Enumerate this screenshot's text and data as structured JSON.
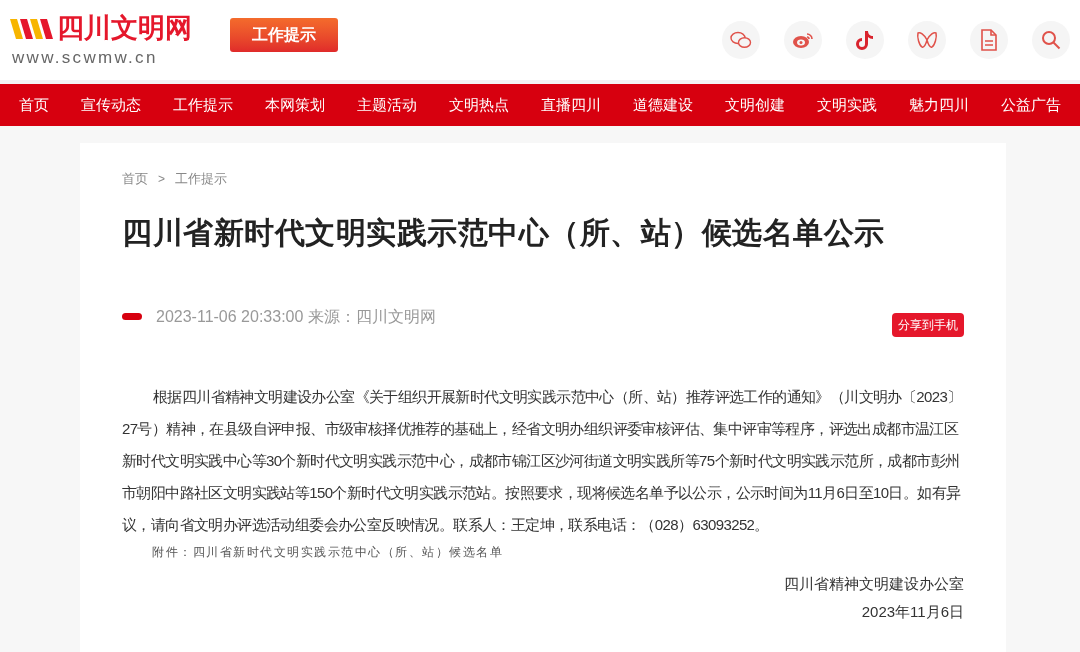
{
  "header": {
    "logo_title": "四川文明网",
    "logo_url": "www.scwmw.cn",
    "badge": "工作提示"
  },
  "nav": [
    {
      "label": "首页"
    },
    {
      "label": "宣传动态"
    },
    {
      "label": "工作提示"
    },
    {
      "label": "本网策划"
    },
    {
      "label": "主题活动"
    },
    {
      "label": "文明热点"
    },
    {
      "label": "直播四川"
    },
    {
      "label": "道德建设"
    },
    {
      "label": "文明创建"
    },
    {
      "label": "文明实践"
    },
    {
      "label": "魅力四川"
    },
    {
      "label": "公益广告"
    }
  ],
  "breadcrumb": [
    "首页",
    ">",
    "工作提示"
  ],
  "article": {
    "title": "四川省新时代文明实践示范中心（所、站）候选名单公示",
    "meta": "2023-11-06 20:33:00 来源：四川文明网",
    "share_button": "分享到手机",
    "paragraph": "根据四川省精神文明建设办公室《关于组织开展新时代文明实践示范中心（所、站）推荐评选工作的通知》（川文明办〔2023〕27号）精神，在县级自评申报、市级审核择优推荐的基础上，经省文明办组织评委审核评估、集中评审等程序，评选出成都市温江区新时代文明实践中心等30个新时代文明实践示范中心，成都市锦江区沙河街道文明实践所等75个新时代文明实践示范所，成都市彭州市朝阳中路社区文明实践站等150个新时代文明实践示范站。按照要求，现将候选名单予以公示，公示时间为11月6日至10日。如有异议，请向省文明办评选活动组委会办公室反映情况。联系人：王定坤，联系电话：（028）63093252。",
    "attachment": "附件：四川省新时代文明实践示范中心（所、站）候选名单",
    "signature": "四川省精神文明建设办公室",
    "date": "2023年11月6日"
  }
}
